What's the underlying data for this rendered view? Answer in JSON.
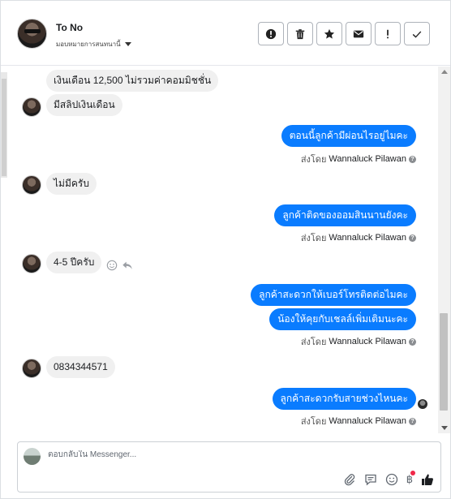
{
  "header": {
    "contact_name": "To No",
    "assign_label": "มอบหมายการสนทนานี้",
    "actions": [
      {
        "name": "report-spam-button",
        "icon": "alert-circle-icon"
      },
      {
        "name": "delete-button",
        "icon": "trash-icon"
      },
      {
        "name": "star-button",
        "icon": "star-icon"
      },
      {
        "name": "mark-unread-button",
        "icon": "envelope-icon"
      },
      {
        "name": "follow-up-button",
        "icon": "exclamation-icon"
      },
      {
        "name": "mark-done-button",
        "icon": "check-icon"
      }
    ]
  },
  "thread": {
    "messages": [
      {
        "dir": "in",
        "text": "เงินเดือน 12,500 ไม่รวมค่าคอมมิชชั่น"
      },
      {
        "dir": "in",
        "text": "มีสลิปเงินเดือน"
      },
      {
        "dir": "out",
        "text": "ตอนนี้ลูกค้ามีผ่อนไรอยู่ไมคะ"
      },
      {
        "dir": "in",
        "text": "ไม่มีครับ"
      },
      {
        "dir": "out",
        "text": "ลูกค้าติดของออมสินนานยังคะ"
      },
      {
        "dir": "in",
        "text": "4-5 ปีครับ"
      },
      {
        "dir": "out",
        "text": "ลูกค้าสะดวกให้เบอร์โทรติดต่อไมคะ"
      },
      {
        "dir": "out",
        "text": "น้องให้คุยกับเชลล์เพิ่มเติมนะคะ"
      },
      {
        "dir": "in",
        "text": "0834344571"
      },
      {
        "dir": "out",
        "text": "ลูกค้าสะดวกรับสายช่วงไหนคะ"
      }
    ],
    "sent_by_prefix": "ส่งโดย",
    "sender_name": "Wannaluck Pilawan",
    "help_glyph": "?"
  },
  "composer": {
    "placeholder": "ตอบกลับใน Messenger...",
    "baht_glyph": "฿",
    "tools": [
      "attachment-icon",
      "saved-reply-icon",
      "emoji-icon",
      "payment-icon",
      "like-icon"
    ]
  },
  "colors": {
    "outgoing_bubble": "#0a7cff",
    "incoming_bubble": "#f0f0f0",
    "notification_dot": "#f02849"
  }
}
